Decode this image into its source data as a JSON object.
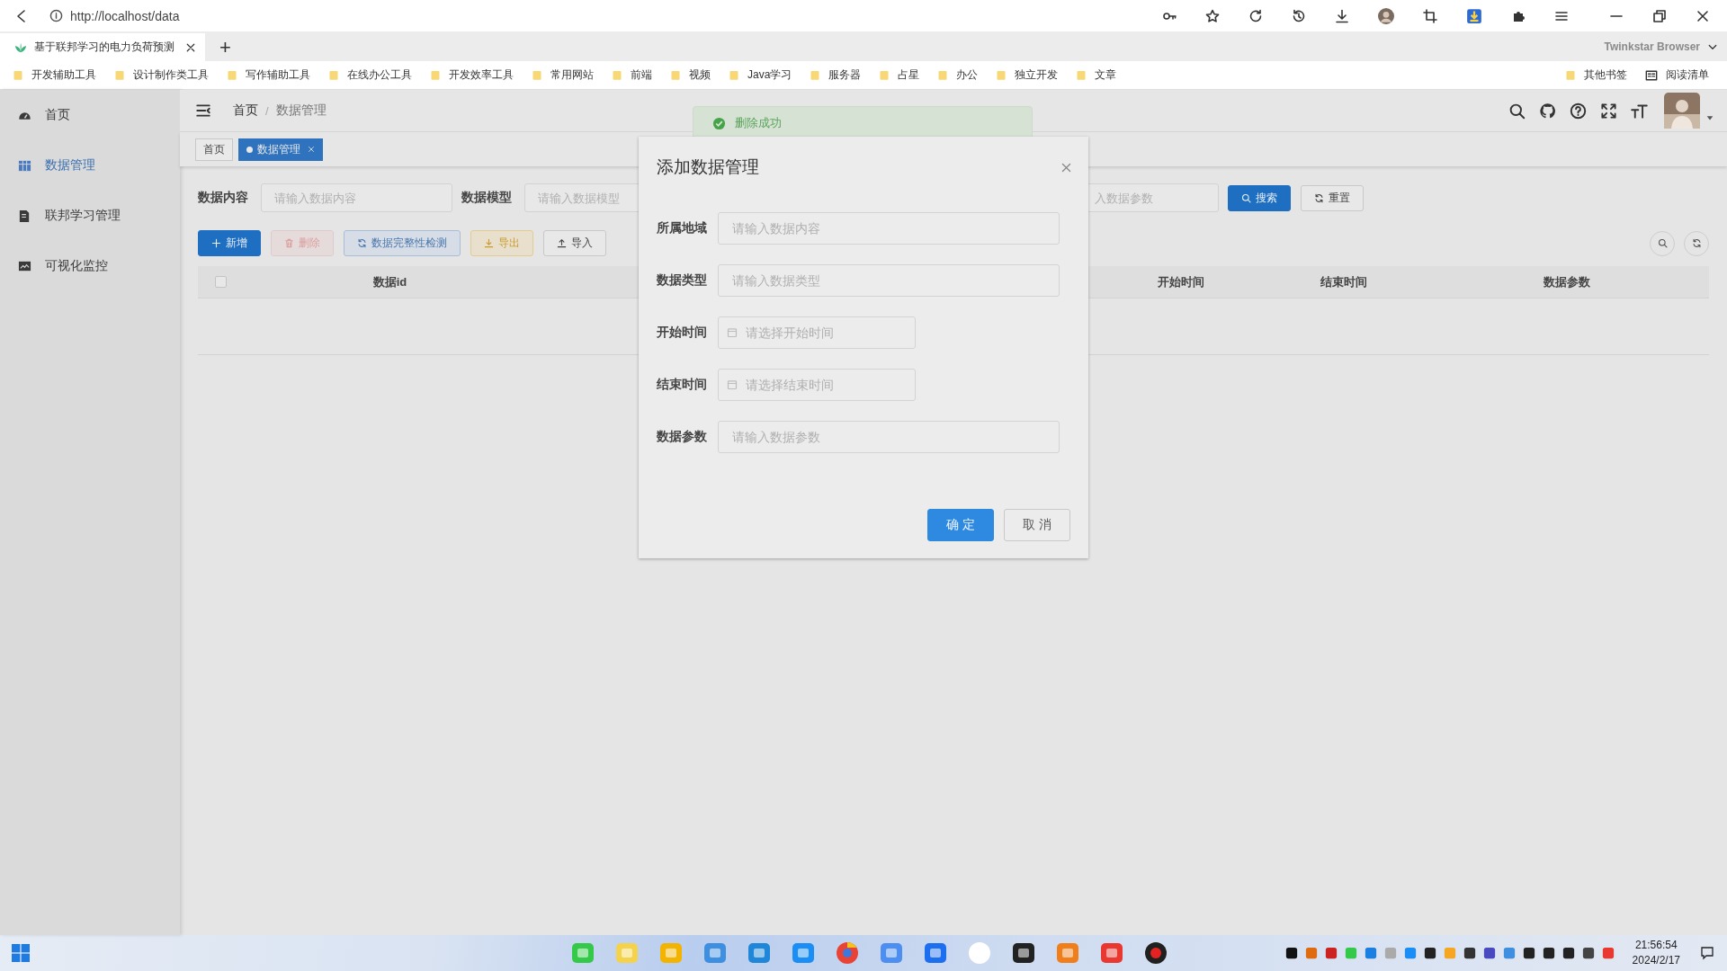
{
  "browser": {
    "url": "http://localhost/data",
    "tab": {
      "title": "基于联邦学习的电力负荷预测"
    },
    "new_tab": "+",
    "brand": "Twinkstar Browser",
    "bookmarks": [
      {
        "label": "开发辅助工具"
      },
      {
        "label": "设计制作类工具"
      },
      {
        "label": "写作辅助工具"
      },
      {
        "label": "在线办公工具"
      },
      {
        "label": "开发效率工具"
      },
      {
        "label": "常用网站"
      },
      {
        "label": "前端"
      },
      {
        "label": "视频"
      },
      {
        "label": "Java学习"
      },
      {
        "label": "服务器"
      },
      {
        "label": "占星"
      },
      {
        "label": "办公"
      },
      {
        "label": "独立开发"
      },
      {
        "label": "文章"
      }
    ],
    "other_bookmarks": "其他书签",
    "reading_list": "阅读清单"
  },
  "sidebar": {
    "items": [
      {
        "label": "首页",
        "selected": false
      },
      {
        "label": "数据管理",
        "selected": true
      },
      {
        "label": "联邦学习管理",
        "selected": false
      },
      {
        "label": "可视化监控",
        "selected": false
      }
    ]
  },
  "header": {
    "breadcrumb": [
      {
        "label": "首页"
      },
      {
        "label": "数据管理"
      }
    ],
    "separator": "/"
  },
  "tags": [
    {
      "label": "首页",
      "selected": false
    },
    {
      "label": "数据管理",
      "selected": true
    }
  ],
  "toast": {
    "message": "删除成功"
  },
  "filters": [
    {
      "label": "数据内容",
      "kind": "text",
      "placeholder": "请输入数据内容"
    },
    {
      "label": "数据模型",
      "kind": "text",
      "placeholder": "请输入数据模型"
    },
    {
      "kind": "text",
      "placeholder": "入数据参数"
    }
  ],
  "search_buttons": [
    {
      "label": "搜索",
      "kind": "primary"
    },
    {
      "label": "重置",
      "kind": "default"
    }
  ],
  "toolbar": [
    {
      "label": "新增",
      "kind": "primary",
      "disabled": false
    },
    {
      "label": "删除",
      "kind": "danger",
      "disabled": true
    },
    {
      "label": "数据完整性检测",
      "kind": "info",
      "disabled": false
    },
    {
      "label": "导出",
      "kind": "warning",
      "disabled": false
    },
    {
      "label": "导入",
      "kind": "default",
      "disabled": false
    }
  ],
  "table": {
    "header_checkbox": {
      "checked": false
    },
    "columns": [
      "数据id",
      "开始时间",
      "结束时间",
      "数据参数"
    ]
  },
  "dialog": {
    "title": "添加数据管理",
    "fields": [
      {
        "label": "所属地域",
        "kind": "text",
        "placeholder": "请输入数据内容"
      },
      {
        "label": "数据类型",
        "kind": "text",
        "placeholder": "请输入数据类型"
      },
      {
        "label": "开始时间",
        "kind": "date",
        "placeholder": "请选择开始时间"
      },
      {
        "label": "结束时间",
        "kind": "date",
        "placeholder": "请选择结束时间"
      },
      {
        "label": "数据参数",
        "kind": "text",
        "placeholder": "请输入数据参数"
      }
    ],
    "buttons": [
      {
        "label": "确 定",
        "kind": "primary"
      },
      {
        "label": "取 消",
        "kind": "default"
      }
    ]
  },
  "taskbar": {
    "time": "21:56:54",
    "date": "2024/2/17"
  }
}
